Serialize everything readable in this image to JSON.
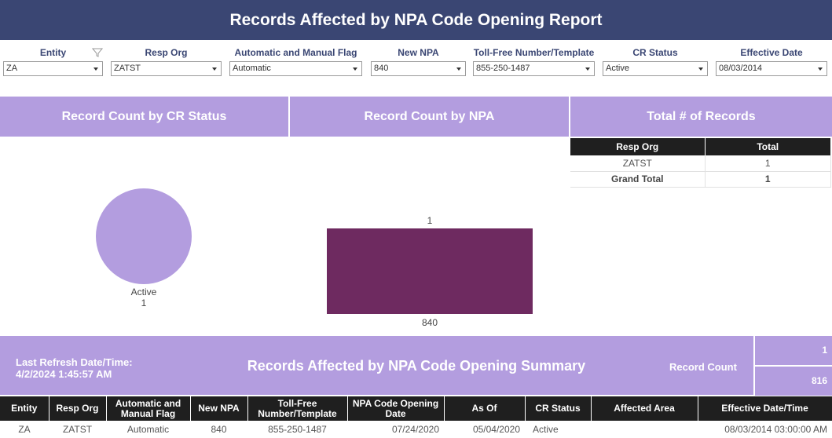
{
  "header": {
    "title": "Records Affected by NPA Code Opening Report"
  },
  "filters": [
    {
      "label": "Entity",
      "value": "ZA",
      "has_funnel": true
    },
    {
      "label": "Resp Org",
      "value": "ZATST"
    },
    {
      "label": "Automatic and Manual Flag",
      "value": "Automatic"
    },
    {
      "label": "New NPA",
      "value": "840"
    },
    {
      "label": "Toll-Free Number/Template",
      "value": "855-250-1487"
    },
    {
      "label": "CR Status",
      "value": "Active"
    },
    {
      "label": "Effective Date",
      "value": "08/03/2014"
    }
  ],
  "panels": {
    "cr_status_title": "Record Count by CR Status",
    "npa_title": "Record Count by NPA",
    "total_title": "Total # of Records"
  },
  "total_table": {
    "headers": [
      "Resp Org",
      "Total"
    ],
    "rows": [
      [
        "ZATST",
        "1"
      ]
    ],
    "grand_total": [
      "Grand Total",
      "1"
    ]
  },
  "chart_data": [
    {
      "type": "pie",
      "title": "Record Count by CR Status",
      "slices": [
        {
          "label": "Active",
          "value": 1,
          "color": "#b39ddf"
        }
      ]
    },
    {
      "type": "bar",
      "title": "Record Count by NPA",
      "categories": [
        "840"
      ],
      "values": [
        1
      ],
      "color": "#6e2a60"
    }
  ],
  "summary": {
    "refresh_label": "Last Refresh Date/Time:",
    "refresh_value": "4/2/2024 1:45:57 AM",
    "title": "Records Affected by NPA Code Opening Summary",
    "record_count_label": "Record Count",
    "record_count_values": [
      "1",
      "816"
    ]
  },
  "detail_table": {
    "headers": [
      "Entity",
      "Resp Org",
      "Automatic and Manual Flag",
      "New NPA",
      "Toll-Free Number/Template",
      "NPA Code Opening Date",
      "As Of",
      "CR Status",
      "Affected Area",
      "Effective Date/Time"
    ],
    "rows": [
      [
        "ZA",
        "ZATST",
        "Automatic",
        "840",
        "855-250-1487",
        "07/24/2020",
        "05/04/2020",
        "Active",
        "",
        "08/03/2014 03:00:00 AM"
      ]
    ]
  },
  "colors": {
    "header_bg": "#3a4673",
    "accent": "#b39ddf",
    "bar": "#6e2a60",
    "table_header": "#1f1f1f"
  }
}
